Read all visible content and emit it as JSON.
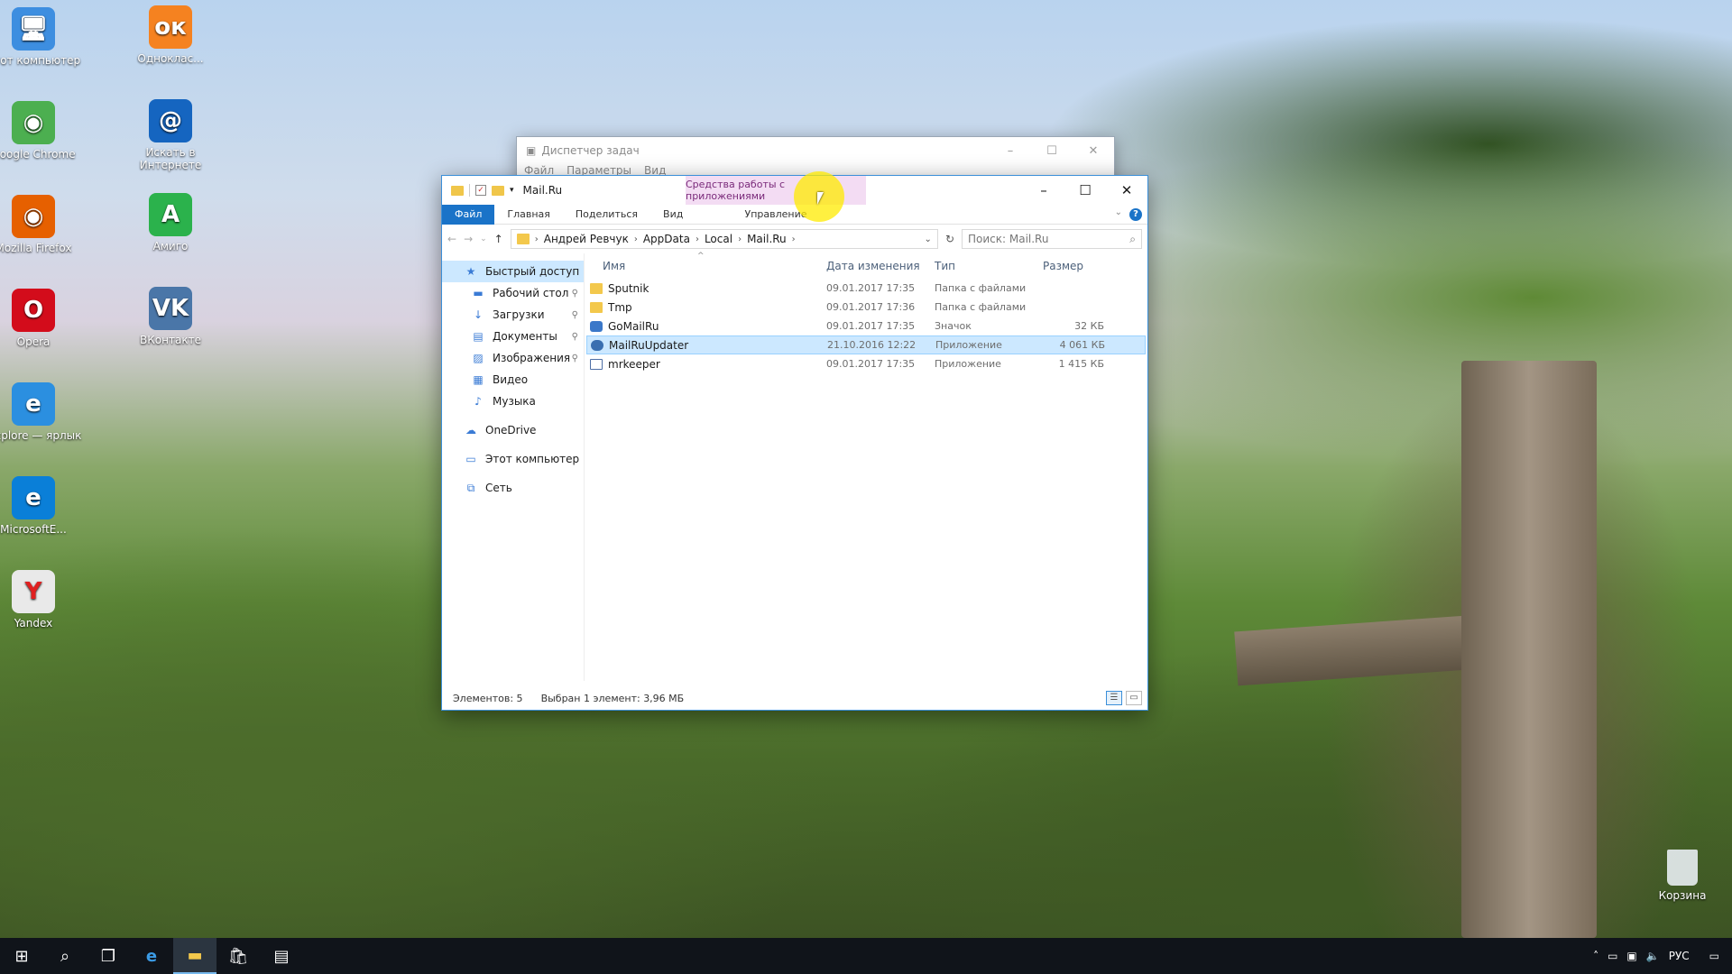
{
  "desktop": {
    "icons_left": [
      {
        "name": "computer",
        "label": "Этот компьютер",
        "color": "#3d8ee0",
        "glyph": "🖥"
      },
      {
        "name": "chrome",
        "label": "Google Chrome",
        "color": "#4caf50",
        "glyph": "◉"
      },
      {
        "name": "firefox",
        "label": "Mozilla Firefox",
        "color": "#e66000",
        "glyph": "◉"
      },
      {
        "name": "opera",
        "label": "Opera",
        "color": "#d30c1b",
        "glyph": "O"
      },
      {
        "name": "iexplore",
        "label": "iexplore — ярлык",
        "color": "#2b8fe0",
        "glyph": "e"
      },
      {
        "name": "edge",
        "label": "MicrosoftE...",
        "color": "#0a7fd8",
        "glyph": "e"
      },
      {
        "name": "yandex",
        "label": "Yandex",
        "color": "#e9e9e9",
        "glyph": "Y"
      }
    ],
    "icons_right": [
      {
        "name": "odnoklassniki",
        "label": "Одноклас...",
        "color": "#f58220",
        "glyph": "ок"
      },
      {
        "name": "mailru-search",
        "label": "Искать в Интернете",
        "color": "#1565c0",
        "glyph": "@"
      },
      {
        "name": "amigo",
        "label": "Амиго",
        "color": "#2bb24c",
        "glyph": "A"
      },
      {
        "name": "vkontakte",
        "label": "ВКонтакте",
        "color": "#4a76a8",
        "glyph": "VK"
      }
    ],
    "recycle_bin": "Корзина"
  },
  "task_manager": {
    "title": "Диспетчер задач",
    "menu": [
      "Файл",
      "Параметры",
      "Вид"
    ]
  },
  "explorer": {
    "title": "Mail.Ru",
    "context_tab": "Средства работы с приложениями",
    "ribbon_tabs": [
      "Файл",
      "Главная",
      "Поделиться",
      "Вид"
    ],
    "ribbon_manage": "Управление",
    "breadcrumbs": [
      "Андрей Ревчук",
      "AppData",
      "Local",
      "Mail.Ru"
    ],
    "search_placeholder": "Поиск: Mail.Ru",
    "nav": [
      {
        "label": "Быстрый доступ",
        "icon": "star-icon",
        "glyph": "★",
        "level": 0,
        "selected": true,
        "pin": false
      },
      {
        "label": "Рабочий стол",
        "icon": "desktop-icon",
        "glyph": "▬",
        "level": 1,
        "pin": true
      },
      {
        "label": "Загрузки",
        "icon": "download-icon",
        "glyph": "↓",
        "level": 1,
        "pin": true
      },
      {
        "label": "Документы",
        "icon": "documents-icon",
        "glyph": "▤",
        "level": 1,
        "pin": true
      },
      {
        "label": "Изображения",
        "icon": "pictures-icon",
        "glyph": "▨",
        "level": 1,
        "pin": true
      },
      {
        "label": "Видео",
        "icon": "video-icon",
        "glyph": "▦",
        "level": 1,
        "pin": false
      },
      {
        "label": "Музыка",
        "icon": "music-icon",
        "glyph": "♪",
        "level": 1,
        "pin": false
      },
      {
        "label": "OneDrive",
        "icon": "onedrive-icon",
        "glyph": "☁",
        "level": 0,
        "pin": false
      },
      {
        "label": "Этот компьютер",
        "icon": "computer-icon",
        "glyph": "▭",
        "level": 0,
        "pin": false
      },
      {
        "label": "Сеть",
        "icon": "network-icon",
        "glyph": "⧉",
        "level": 0,
        "pin": false
      }
    ],
    "columns": {
      "name": "Имя",
      "date": "Дата изменения",
      "type": "Тип",
      "size": "Размер"
    },
    "files": [
      {
        "name": "Sputnik",
        "date": "09.01.2017 17:35",
        "type": "Папка с файлами",
        "size": "",
        "kind": "folder",
        "selected": false
      },
      {
        "name": "Tmp",
        "date": "09.01.2017 17:36",
        "type": "Папка с файлами",
        "size": "",
        "kind": "folder",
        "selected": false
      },
      {
        "name": "GoMailRu",
        "date": "09.01.2017 17:35",
        "type": "Значок",
        "size": "32 КБ",
        "kind": "ico",
        "selected": false
      },
      {
        "name": "MailRuUpdater",
        "date": "21.10.2016 12:22",
        "type": "Приложение",
        "size": "4 061 КБ",
        "kind": "app",
        "selected": true
      },
      {
        "name": "mrkeeper",
        "date": "09.01.2017 17:35",
        "type": "Приложение",
        "size": "1 415 КБ",
        "kind": "exe",
        "selected": false
      }
    ],
    "status_count": "Элементов: 5",
    "status_selected": "Выбран 1 элемент: 3,96 МБ"
  },
  "taskbar": {
    "tray_language": "РУС"
  }
}
